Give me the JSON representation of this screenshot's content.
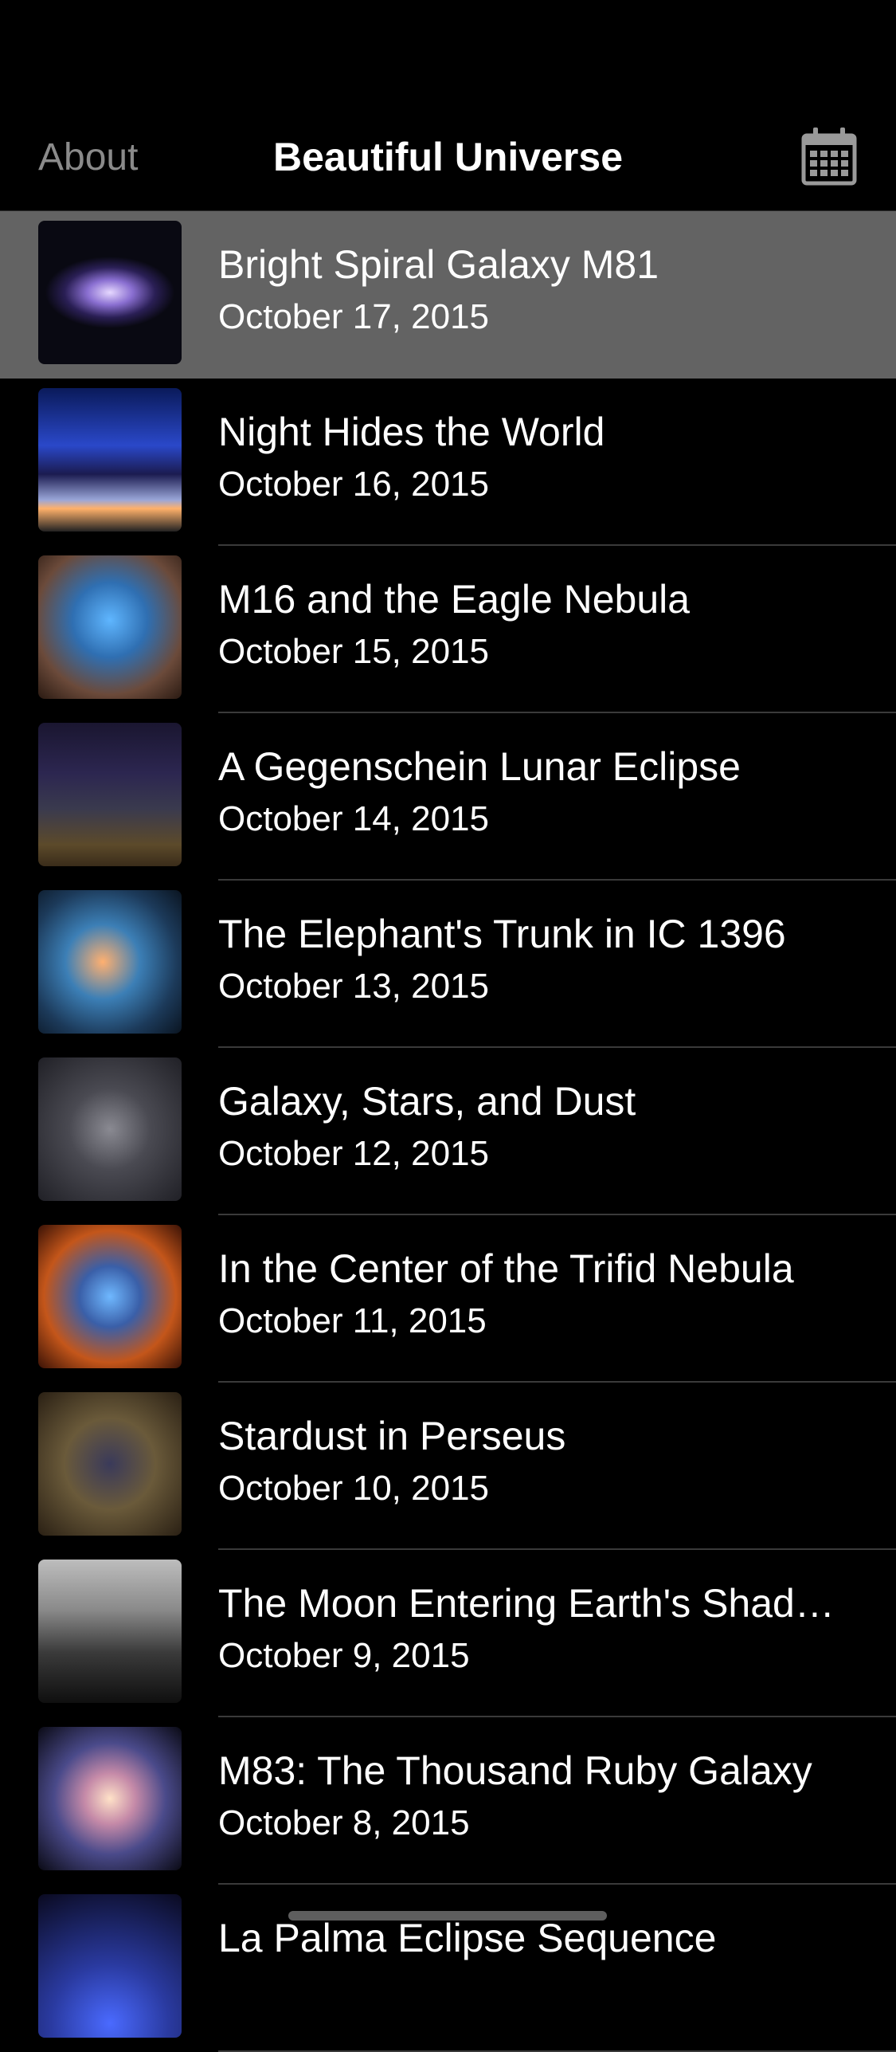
{
  "nav": {
    "about_label": "About",
    "title": "Beautiful Universe",
    "calendar_icon": "calendar-icon"
  },
  "items": [
    {
      "title": "Bright Spiral Galaxy M81",
      "date": "October 17, 2015",
      "selected": true,
      "thumb": "radial-gradient(ellipse 45% 25% at 50% 50%, #e6d8ff 0%, #8a6fd1 35%, #2a1f55 70%, #090912 100%)"
    },
    {
      "title": "Night Hides the World",
      "date": "October 16, 2015",
      "thumb": "linear-gradient(180deg, #0a1a5a 0%, #2a48c9 40%, #1b1b50 60%, #9aa6d8 78%, #ffb16a 84%, #222 100%)"
    },
    {
      "title": "M16 and the Eagle Nebula",
      "date": "October 15, 2015",
      "thumb": "radial-gradient(circle at 50% 45%, #5fb6ff 0%, #2f6fb2 35%, #6b4a3a 70%, #2a1a12 100%)"
    },
    {
      "title": "A Gegenschein Lunar Eclipse",
      "date": "October 14, 2015",
      "thumb": "linear-gradient(180deg, #1a1630 0%, #2c2650 35%, #3a3a4e 60%, #5c4a2a 85%, #3a2c1a 100%)"
    },
    {
      "title": "The Elephant's Trunk in IC 1396",
      "date": "October 13, 2015",
      "thumb": "radial-gradient(circle at 45% 50%, #ffb070 0%, #3c7fb6 35%, #1c3a5a 70%, #0a1420 100%)"
    },
    {
      "title": "Galaxy, Stars, and Dust",
      "date": "October 12, 2015",
      "thumb": "radial-gradient(circle at 50% 50%, #8a8a92 0%, #4a4a52 40%, #202026 100%)"
    },
    {
      "title": "In the Center of the Trifid Nebula",
      "date": "October 11, 2015",
      "thumb": "radial-gradient(circle at 50% 50%, #6fb8ff 0%, #3a5fa8 30%, #c4561a 65%, #3a1206 100%)"
    },
    {
      "title": "Stardust in Perseus",
      "date": "October 10, 2015",
      "thumb": "radial-gradient(circle at 50% 50%, #3a3a5a 0%, #6a5a3a 45%, #2a2014 100%)"
    },
    {
      "title": "The Moon Entering Earth's Shad…",
      "date": "October 9, 2015",
      "thumb": "linear-gradient(180deg, #bdbdbd 0%, #8a8a8a 35%, #3a3a3a 65%, #0f0f0f 100%)"
    },
    {
      "title": "M83: The Thousand Ruby Galaxy",
      "date": "October 8, 2015",
      "thumb": "radial-gradient(circle at 50% 50%, #ffe2c8 0%, #c58aa8 25%, #4a4a8a 55%, #0a0a14 100%)"
    },
    {
      "title": "La Palma Eclipse Sequence",
      "date": "",
      "thumb": "radial-gradient(circle at 50% 90%, #4a6aff 0%, #2a3aa0 40%, #0a0a20 100%)"
    }
  ]
}
